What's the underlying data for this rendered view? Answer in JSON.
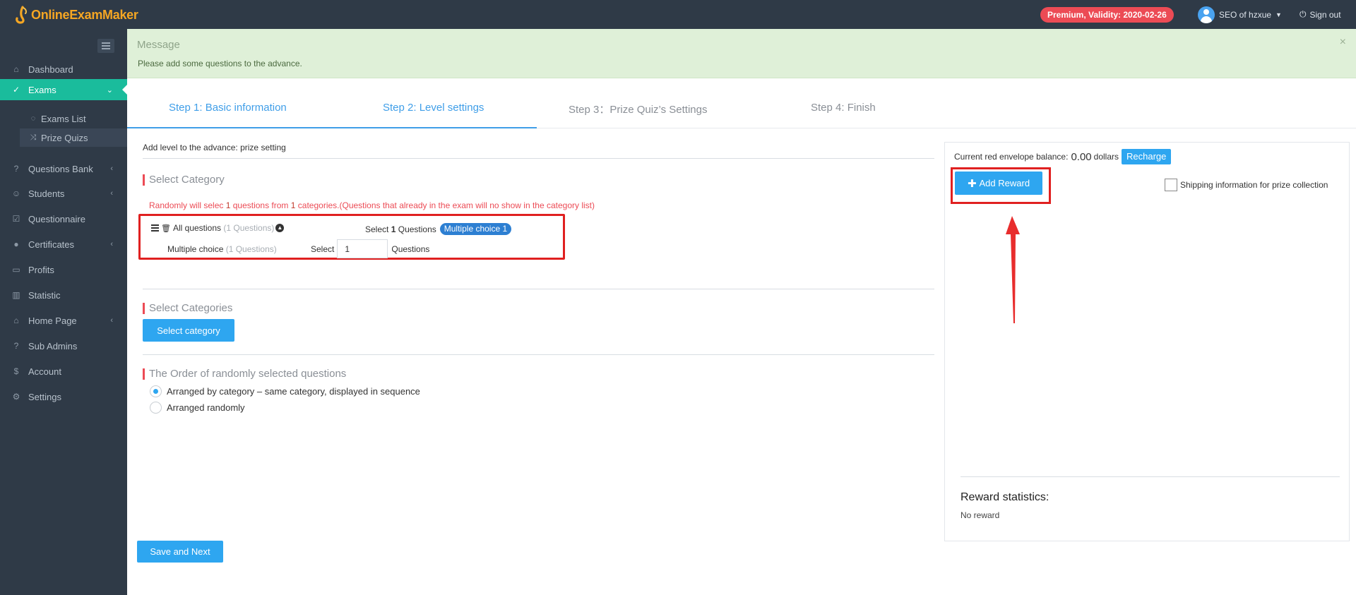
{
  "app": {
    "logo_text": "OnlineExamMaker"
  },
  "topbar": {
    "premium_badge": "Premium, Validity: 2020-02-26",
    "user_name": "SEO of hzxue",
    "sign_out": "Sign out"
  },
  "sidebar": {
    "items": [
      {
        "label": "Dashboard",
        "icon": "home-icon"
      },
      {
        "label": "Exams",
        "icon": "check-circle-icon",
        "active": true
      },
      {
        "label": "Questions Bank",
        "icon": "question-circle-icon"
      },
      {
        "label": "Students",
        "icon": "user-icon"
      },
      {
        "label": "Questionnaire",
        "icon": "checkbox-icon"
      },
      {
        "label": "Certificates",
        "icon": "certificate-icon"
      },
      {
        "label": "Profits",
        "icon": "card-icon"
      },
      {
        "label": "Statistic",
        "icon": "bar-chart-icon"
      },
      {
        "label": "Home Page",
        "icon": "hat-icon"
      },
      {
        "label": "Sub Admins",
        "icon": "question-circle-icon"
      },
      {
        "label": "Account",
        "icon": "dollar-icon"
      },
      {
        "label": "Settings",
        "icon": "gear-icon"
      }
    ],
    "sub_items": [
      {
        "label": "Exams List",
        "icon": "check-circle-icon"
      },
      {
        "label": "Prize Quizs",
        "icon": "shuffle-icon"
      }
    ]
  },
  "message": {
    "title": "Message",
    "text": "Please add some questions to the advance.",
    "close": "×"
  },
  "steps": [
    {
      "label": "Step 1: Basic information"
    },
    {
      "label": "Step 2: Level settings"
    },
    {
      "label": "Step 3：Prize Quiz’s Settings"
    },
    {
      "label": "Step 4: Finish"
    }
  ],
  "main": {
    "heading": "Add level to the advance: prize setting",
    "select_category_title": "Select Category",
    "random_notice_prefix": "Randomly will selec ",
    "random_notice_count": "1",
    "random_notice_mid": " questions from ",
    "random_notice_cats": "1",
    "random_notice_suffix": " categories.(Questions that already in the exam will no show in the category list)",
    "all_questions_label": "All questions",
    "all_questions_count": "(1 Questions)",
    "select_label": "Select",
    "select_count": "1",
    "questions_label": "Questions",
    "multiple_choice_pill": "Multiple choice 1",
    "multiple_choice_label": "Multiple choice",
    "multiple_choice_count": "(1 Questions)",
    "select_input_value": "1",
    "select_categories_title": "Select Categories",
    "select_category_button": "Select category",
    "order_title": "The Order of randomly selected questions",
    "order_options": [
      {
        "label": "Arranged by category – same category, displayed in sequence",
        "selected": true
      },
      {
        "label": "Arranged randomly",
        "selected": false
      }
    ],
    "save_button": "Save and Next"
  },
  "right": {
    "balance_label": "Current red envelope balance:",
    "balance_amount": "0.00",
    "balance_unit": "dollars",
    "recharge_button": "Recharge",
    "add_reward_button": "Add Reward",
    "shipping_label": "Shipping information for prize collection",
    "reward_stats_title": "Reward statistics:",
    "no_reward": "No reward"
  },
  "colors": {
    "sidebar_bg": "#2f3a47",
    "active_green": "#1abc9c",
    "primary_blue": "#2ea6f0",
    "alert_red": "#ec4b55",
    "message_bg": "#dff0d8"
  }
}
